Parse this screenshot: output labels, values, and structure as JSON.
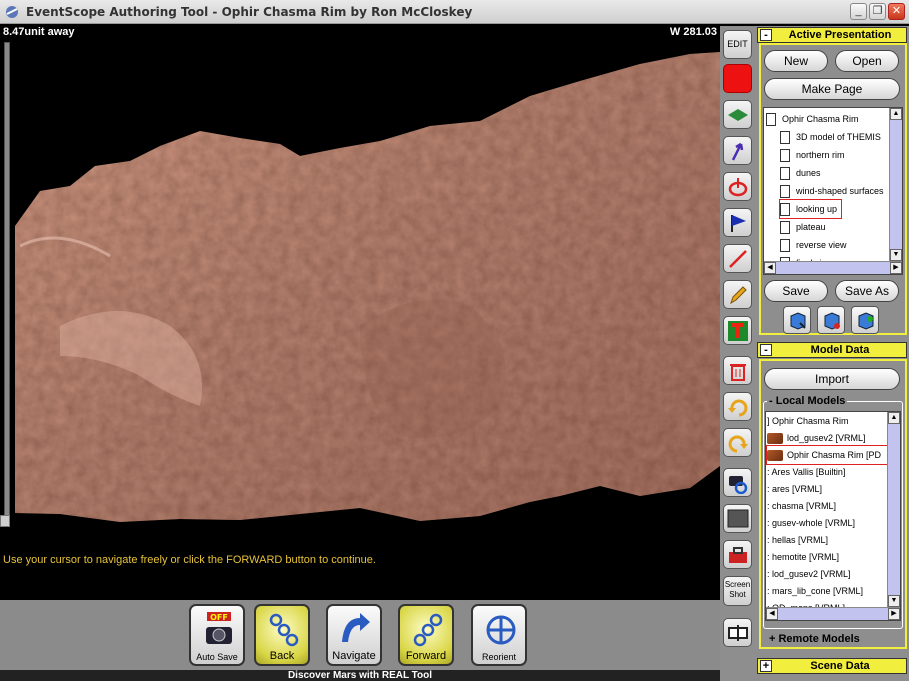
{
  "window": {
    "title": "EventScope Authoring Tool - Ophir Chasma Rim by Ron McCloskey",
    "icons": [
      "app-icon",
      "minimize-icon",
      "restore-icon",
      "close-icon"
    ]
  },
  "viewport": {
    "distance": "8.47unit away",
    "width_readout": "W 281.03",
    "hint": "Use your cursor to navigate freely or click the FORWARD button to continue."
  },
  "navbar": {
    "autosave_badge": "OFF",
    "autosave_label": "Auto Save",
    "back_label": "Back",
    "navigate_label": "Navigate",
    "forward_label": "Forward",
    "reorient_label": "Reorient"
  },
  "statusbar": {
    "text": "Discover Mars with REAL Tool"
  },
  "tools": {
    "edit_label": "EDIT",
    "screenshot_label_1": "Screen",
    "screenshot_label_2": "Shot",
    "colors": {
      "red_swatch": "#e11111",
      "yellow_header": "#f2ee3e"
    }
  },
  "presentation": {
    "header": "Active Presentation",
    "toggle": "-",
    "new_label": "New",
    "open_label": "Open",
    "make_page_label": "Make Page",
    "root_page": "Ophir Chasma Rim",
    "pages": [
      "3D model of THEMIS",
      "northern rim",
      "dunes",
      "wind-shaped surfaces",
      "looking up",
      "plateau",
      "reverse view",
      "final view"
    ],
    "selected_page": "looking up",
    "save_label": "Save",
    "save_as_label": "Save As"
  },
  "model_data": {
    "header": "Model Data",
    "toggle": "-",
    "import_label": "Import",
    "local_models_label": "- Local Models",
    "remote_models_label": "+ Remote Models",
    "models": [
      "] Ophir Chasma Rim",
      "lod_gusev2 [VRML]",
      "Ophir Chasma Rim [PD",
      ": Ares Vallis [Builtin]",
      ": ares [VRML]",
      ": chasma [VRML]",
      ": gusev-whole [VRML]",
      ": hellas [VRML]",
      ": hemotite [VRML]",
      ": lod_gusev2 [VRML]",
      ": mars_lib_cone [VRML]",
      ": OD_mons [VRML]"
    ]
  },
  "scene_data": {
    "header": "Scene Data",
    "toggle": "+"
  }
}
